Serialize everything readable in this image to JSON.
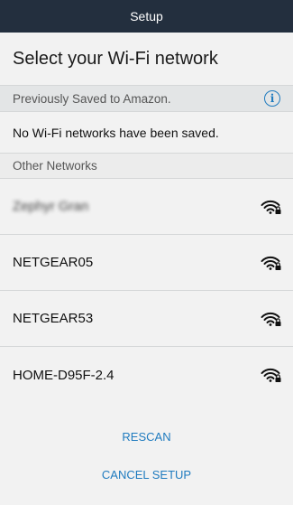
{
  "titlebar": {
    "title": "Setup"
  },
  "heading": "Select your Wi-Fi network",
  "saved_section": {
    "label": "Previously Saved to Amazon.",
    "info_icon": "info-icon",
    "empty_message": "No Wi-Fi networks have been saved."
  },
  "other_section": {
    "label": "Other Networks"
  },
  "networks": [
    {
      "name": "Zephyr Gran"
    },
    {
      "name": "NETGEAR05"
    },
    {
      "name": "NETGEAR53"
    },
    {
      "name": "HOME-D95F-2.4"
    }
  ],
  "actions": {
    "rescan": "RESCAN",
    "cancel": "CANCEL SETUP"
  },
  "colors": {
    "titlebar_bg": "#232f3e",
    "accent": "#1f7bbf",
    "section_bg": "#e3e5e6"
  }
}
